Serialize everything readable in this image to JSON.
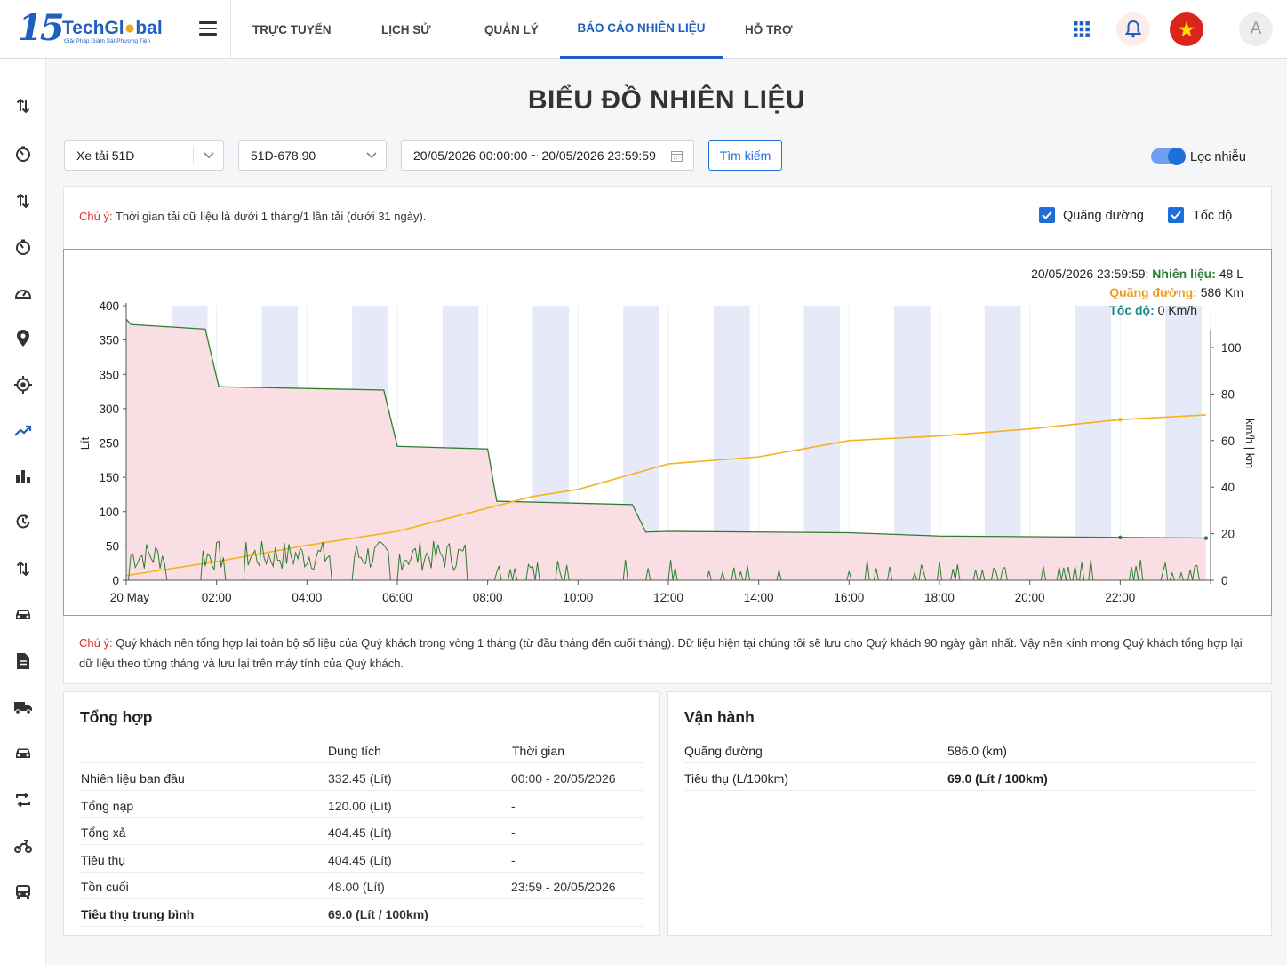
{
  "brand": {
    "number": "15",
    "name_a": "TechGl",
    "name_b": "bal",
    "tagline": "Giải Pháp Giám Sát Phương Tiện"
  },
  "nav": [
    "TRỰC TUYẾN",
    "LỊCH SỬ",
    "QUẢN LÝ",
    "BÁO CÁO NHIÊN LIỆU",
    "HỖ TRỢ"
  ],
  "nav_active": 3,
  "user": {
    "initial": "A"
  },
  "sidebar_icons": [
    "transfer-icon",
    "timer-icon",
    "transfer-icon",
    "timer-icon",
    "speedometer-icon",
    "location-pin-icon",
    "gps-target-icon",
    "trend-chart-icon",
    "bar-chart-icon",
    "history-icon",
    "transfer-icon",
    "car-icon",
    "document-icon",
    "truck-icon",
    "car-icon",
    "route-icon",
    "motorbike-icon",
    "bus-icon"
  ],
  "page": {
    "title": "BIỂU ĐỒ NHIÊN LIỆU"
  },
  "filters": {
    "vehicle_type": "Xe tải 51D",
    "plate": "51D-678.90",
    "date_range": "20/05/2026 00:00:00 ~ 20/05/2026 23:59:59",
    "search_label": "Tìm kiếm",
    "noise_filter_label": "Lọc nhiễu",
    "noise_filter_on": true
  },
  "notice": {
    "prefix": "Chú ý:",
    "text": "Thời gian tải dữ liệu là dưới 1 tháng/1 lần tải (dưới 31 ngày)."
  },
  "toggles": {
    "distance_label": "Quãng đường",
    "speed_label": "Tốc độ",
    "distance_checked": true,
    "speed_checked": true
  },
  "tooltip": {
    "time": "20/05/2026 23:59:59:",
    "fuel_label": "Nhiên liệu:",
    "fuel_value": "48 L",
    "distance_label": "Quãng đường:",
    "distance_value": "586 Km",
    "speed_label": "Tốc độ:",
    "speed_value": "0 Km/h"
  },
  "chart_data": {
    "type": "line",
    "y_left_ticks": [
      "0",
      "50",
      "100",
      "150",
      "250",
      "300",
      "350",
      "350",
      "400"
    ],
    "y_left_label": "Lít",
    "y_right_ticks": [
      "0",
      "20",
      "40",
      "60",
      "80",
      "100"
    ],
    "y_right_label": "km/h | km",
    "x_ticks": [
      "20 May",
      "02:00",
      "04:00",
      "06:00",
      "08:00",
      "10:00",
      "12:00",
      "14:00",
      "16:00",
      "18:00",
      "20:00",
      "22:00"
    ],
    "x_range_hours": [
      0,
      24
    ],
    "colors": {
      "fuel": "#2e7d32",
      "fuel_fill": "#f9dfe3",
      "distance": "#f5b21b",
      "speed": "#2e7d32",
      "band": "#e6e9f7"
    },
    "series": [
      {
        "name": "Nhiên liệu",
        "axis": "left",
        "points": [
          [
            0,
            390
          ],
          [
            0.1,
            382
          ],
          [
            1.75,
            375
          ],
          [
            2.05,
            289
          ],
          [
            5.7,
            284
          ],
          [
            6,
            200
          ],
          [
            8,
            196
          ],
          [
            8.2,
            118
          ],
          [
            11.2,
            113
          ],
          [
            11.5,
            72
          ],
          [
            12,
            73
          ],
          [
            16,
            71
          ],
          [
            18,
            66
          ],
          [
            22,
            64
          ],
          [
            23.9,
            63
          ]
        ]
      },
      {
        "name": "Quãng đường",
        "axis": "right",
        "points": [
          [
            0,
            2
          ],
          [
            2,
            8
          ],
          [
            4,
            15
          ],
          [
            6,
            21
          ],
          [
            8,
            31
          ],
          [
            9,
            36
          ],
          [
            10,
            39
          ],
          [
            12,
            50
          ],
          [
            14,
            53
          ],
          [
            16,
            60
          ],
          [
            18,
            62
          ],
          [
            20,
            65
          ],
          [
            22,
            69
          ],
          [
            23.9,
            71
          ]
        ]
      },
      {
        "name": "Tốc độ",
        "axis": "right",
        "values_note": "speed spikes 0–20 km/h, dense 0:00–7:30, sparse after"
      }
    ]
  },
  "footnote": {
    "prefix": "Chú ý:",
    "text": "Quý khách nên tổng hợp lại toàn bộ số liệu của Quý khách trong vòng 1 tháng (từ đầu tháng đến cuối tháng). Dữ liệu hiện tại chúng tôi sẽ lưu cho Quý khách 90 ngày gần nhất. Vậy nên kính mong Quý khách tổng hợp lại dữ liệu theo từng tháng và lưu lại trên máy tính của Quý khách."
  },
  "summary": {
    "title": "Tổng hợp",
    "col_capacity": "Dung tích",
    "col_time": "Thời gian",
    "rows": [
      {
        "label": "Nhiên liệu ban đầu",
        "capacity": "332.45 (Lít)",
        "time": "00:00 - 20/05/2026",
        "bold": false
      },
      {
        "label": "Tổng nạp",
        "capacity": "120.00 (Lít)",
        "time": "-",
        "bold": false
      },
      {
        "label": "Tổng xả",
        "capacity": "404.45 (Lít)",
        "time": "-",
        "bold": false
      },
      {
        "label": "Tiêu thụ",
        "capacity": "404.45 (Lít)",
        "time": "-",
        "bold": false
      },
      {
        "label": "Tồn cuối",
        "capacity": "48.00 (Lít)",
        "time": "23:59 - 20/05/2026",
        "bold": false
      },
      {
        "label": "Tiêu thụ trung bình",
        "capacity": "69.0 (Lít / 100km)",
        "time": "",
        "bold": true
      }
    ]
  },
  "operation": {
    "title": "Vận hành",
    "rows": [
      {
        "label": "Quãng đường",
        "value": "586.0 (km)"
      },
      {
        "label": "Tiêu thụ (L/100km)",
        "value": "69.0 (Lít / 100km)"
      }
    ]
  }
}
